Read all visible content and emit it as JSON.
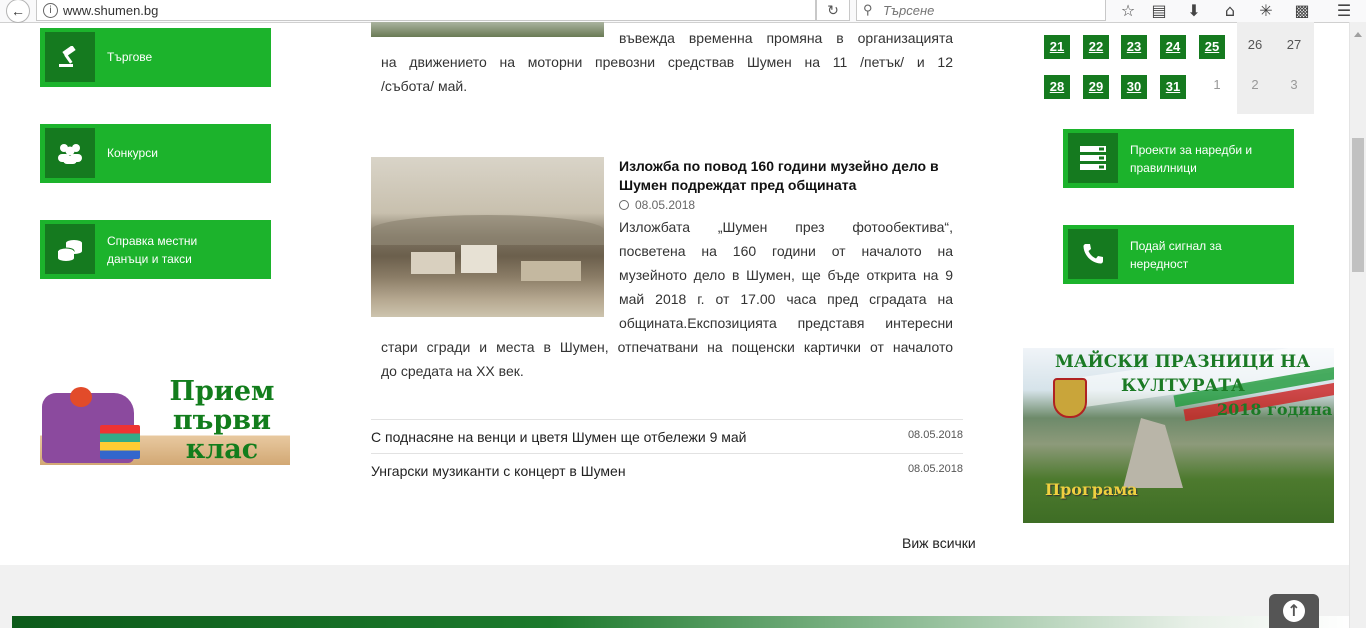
{
  "browser": {
    "url": "www.shumen.bg",
    "search_placeholder": "Търсене",
    "icons": [
      "back-icon",
      "info-icon",
      "reload-icon",
      "search-icon",
      "bookmark-star-icon",
      "reader-icon",
      "download-icon",
      "home-icon",
      "extension-icon",
      "extension-icon",
      "menu-icon"
    ]
  },
  "sidebar": {
    "items": [
      {
        "label": "Търгове",
        "icon": "gavel-icon"
      },
      {
        "label": "Конкурси",
        "icon": "people-icon"
      },
      {
        "label": "Справка местни данъци и такси",
        "icon": "coins-icon"
      }
    ],
    "promo_text": "Прием първи клас"
  },
  "news": {
    "prev_text": [
      "въвежда временна промяна в организацията",
      "на движението на моторни превозни средствав Шумен на 11 /петък/ и 12",
      "/събота/ май."
    ],
    "featured": {
      "title": "Изложба по повод 160 години музейно дело в Шумен подреждат пред общината",
      "date": "08.05.2018",
      "lines_side": [
        "Изложбата „Шумен през фотообектива“,",
        "посветена на 160 години от началото на",
        "музейното дело в Шумен, ще бъде открита на 9",
        "май 2018 г. от 17.00 часа пред сградата на",
        "общината.Експозицията представя интересни"
      ],
      "lines_full": [
        "стари сгради и места в Шумен, отпечатвани на пощенски картички от началото",
        "до средата на XX век."
      ]
    },
    "list": [
      {
        "title": "С поднасяне на венци и цветя Шумен ще отбележи 9 май",
        "date": "08.05.2018"
      },
      {
        "title": "Унгарски музиканти с концерт в Шумен",
        "date": "08.05.2018"
      }
    ],
    "view_all": "Виж всички"
  },
  "calendar": {
    "week1": [
      "21",
      "22",
      "23",
      "24",
      "25",
      "26",
      "27"
    ],
    "week2": [
      "28",
      "29",
      "30",
      "31",
      "1",
      "2",
      "3"
    ]
  },
  "right_buttons": [
    {
      "label": "Проекти за наредби и правилници",
      "icon": "document-list-icon"
    },
    {
      "label": "Подай сигнал за нередност",
      "icon": "phone-icon"
    }
  ],
  "banner": {
    "line1": "МАЙСКИ ПРАЗНИЦИ НА",
    "line2": "КУЛТУРАТА",
    "line3": "2018 година",
    "program": "Програма"
  },
  "colors": {
    "green": "#1cb32c",
    "dark_green": "#157a1f"
  }
}
